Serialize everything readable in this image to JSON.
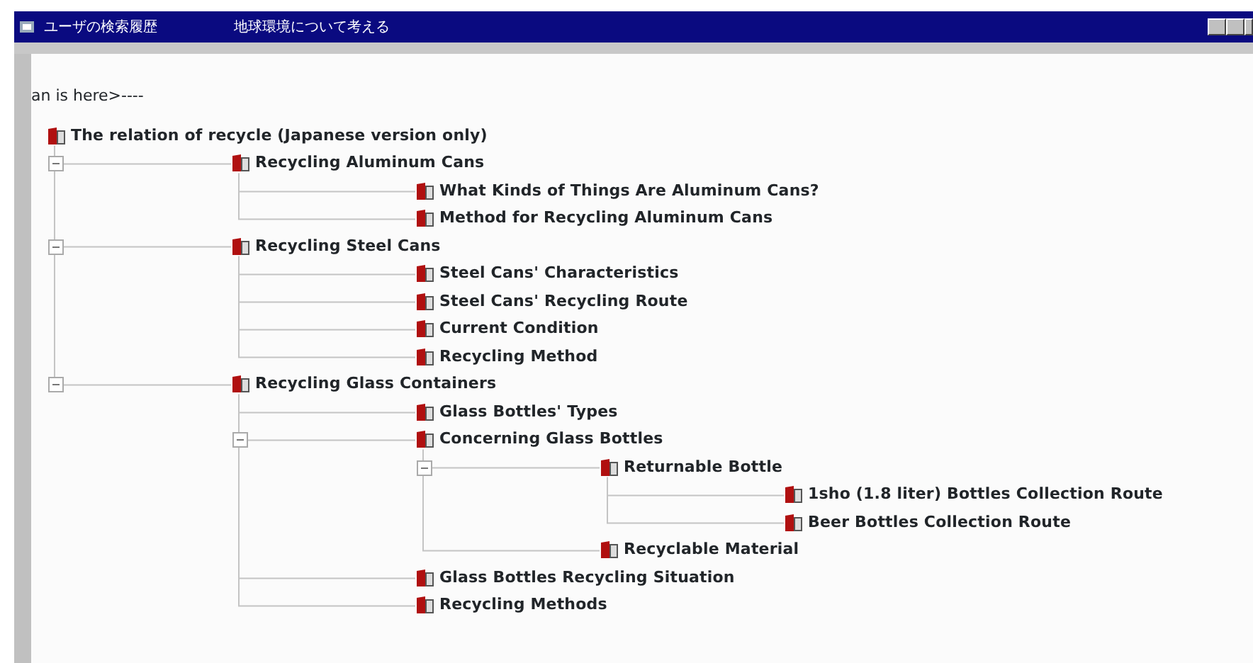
{
  "window": {
    "title": "ユーザの検索履歴",
    "subtitle": "地球環境について考える"
  },
  "location_text": "an is here>----",
  "tree": {
    "label": "The relation of recycle (Japanese version only)",
    "children": [
      {
        "label": "Recycling Aluminum Cans",
        "expanded": true,
        "children": [
          {
            "label": "What Kinds of Things Are Aluminum Cans?"
          },
          {
            "label": "Method for Recycling Aluminum Cans"
          }
        ]
      },
      {
        "label": "Recycling Steel Cans",
        "expanded": true,
        "children": [
          {
            "label": "Steel Cans' Characteristics"
          },
          {
            "label": "Steel Cans' Recycling Route"
          },
          {
            "label": "Current Condition"
          },
          {
            "label": "Recycling Method"
          }
        ]
      },
      {
        "label": "Recycling Glass Containers",
        "expanded": true,
        "children": [
          {
            "label": "Glass Bottles' Types"
          },
          {
            "label": "Concerning Glass Bottles",
            "expanded": true,
            "children": [
              {
                "label": "Returnable Bottle",
                "expanded": true,
                "children": [
                  {
                    "label": "1sho (1.8 liter) Bottles Collection Route"
                  },
                  {
                    "label": "Beer Bottles Collection Route"
                  }
                ]
              },
              {
                "label": "Recyclable Material"
              }
            ]
          },
          {
            "label": "Glass Bottles Recycling Situation"
          },
          {
            "label": "Recycling Methods"
          }
        ]
      }
    ]
  }
}
